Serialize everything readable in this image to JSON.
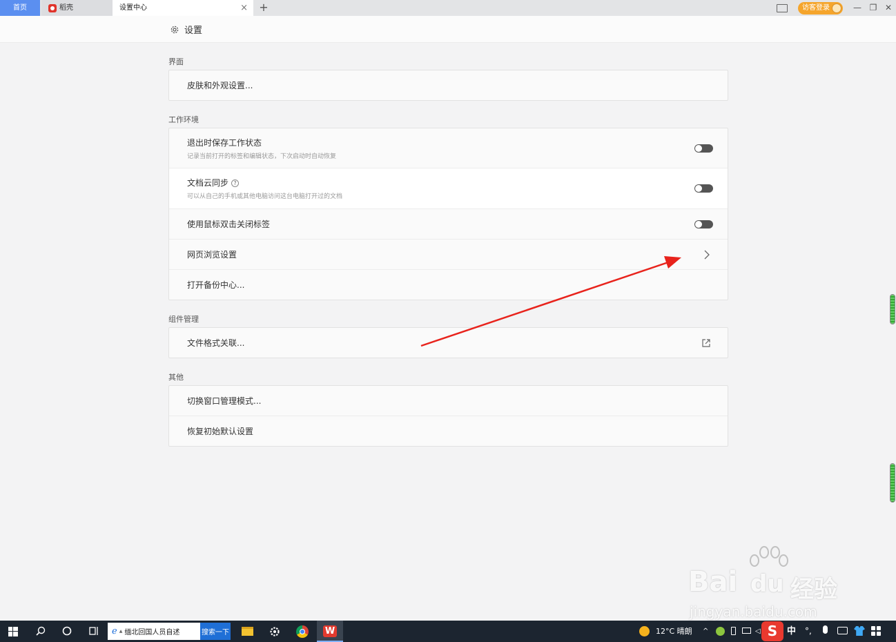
{
  "tabs": {
    "home": "首页",
    "daoke": "稻壳",
    "settings": "设置中心"
  },
  "window": {
    "login_label": "访客登录"
  },
  "header": {
    "title": "设置"
  },
  "sections": {
    "interface": {
      "title": "界面",
      "items": [
        "皮肤和外观设置..."
      ]
    },
    "workspace": {
      "title": "工作环境",
      "items": [
        {
          "label": "退出时保存工作状态",
          "sub": "记录当前打开的标签和编辑状态，下次启动时自动恢复",
          "toggle": false
        },
        {
          "label": "文档云同步",
          "sub": "可以从自己的手机或其他电脑访问这台电脑打开过的文档",
          "toggle": false
        },
        {
          "label": "使用鼠标双击关闭标签",
          "toggle": false
        },
        {
          "label": "网页浏览设置"
        },
        {
          "label": "打开备份中心..."
        }
      ]
    },
    "components": {
      "title": "组件管理",
      "items": [
        "文件格式关联..."
      ]
    },
    "other": {
      "title": "其他",
      "items": [
        "切换窗口管理模式...",
        "恢复初始默认设置"
      ]
    }
  },
  "taskbar": {
    "search_text": "缅北回国人员自述",
    "search_button": "搜索一下",
    "weather": "12°C  晴朗",
    "ime": "中"
  },
  "watermark": {
    "brand": "Bai",
    "brand2": "du",
    "cn": "经验",
    "url": "jingyan.baidu.com"
  },
  "colors": {
    "home_tab": "#5b8ff0",
    "login_button": "#f5a52c",
    "annotation_arrow": "#e8231c"
  }
}
